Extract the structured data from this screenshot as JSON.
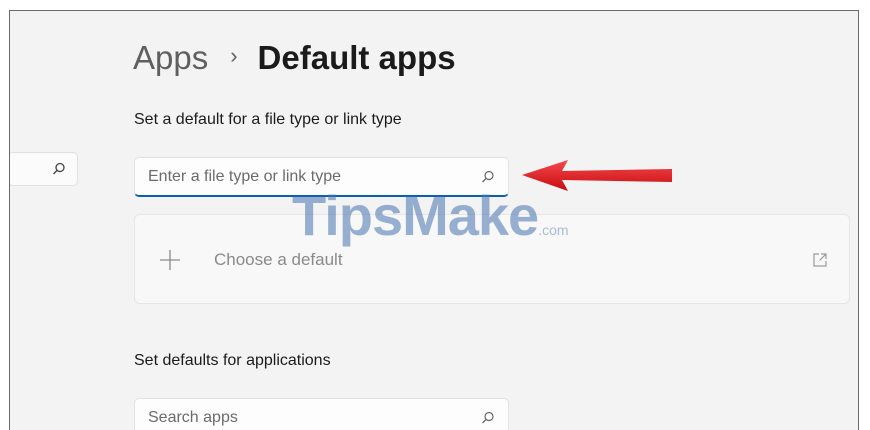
{
  "breadcrumb": {
    "parent": "Apps",
    "separator": "›",
    "current": "Default apps"
  },
  "file_type_section": {
    "label": "Set a default for a file type or link type",
    "search_placeholder": "Enter a file type or link type",
    "choose_default_label": "Choose a default"
  },
  "apps_section": {
    "label": "Set defaults for applications",
    "search_placeholder": "Search apps"
  },
  "watermark": {
    "text": "TipsMake",
    "suffix": ".com"
  },
  "icons": {
    "sidebar_search": "search-icon",
    "file_type_search": "search-icon",
    "add": "plus-icon",
    "open_external": "open-external-icon",
    "apps_search": "search-icon",
    "annotation": "red-arrow"
  },
  "colors": {
    "accent_underline": "#0a5fb0",
    "annotation_arrow": "#e0161c",
    "background": "#f3f3f3"
  }
}
